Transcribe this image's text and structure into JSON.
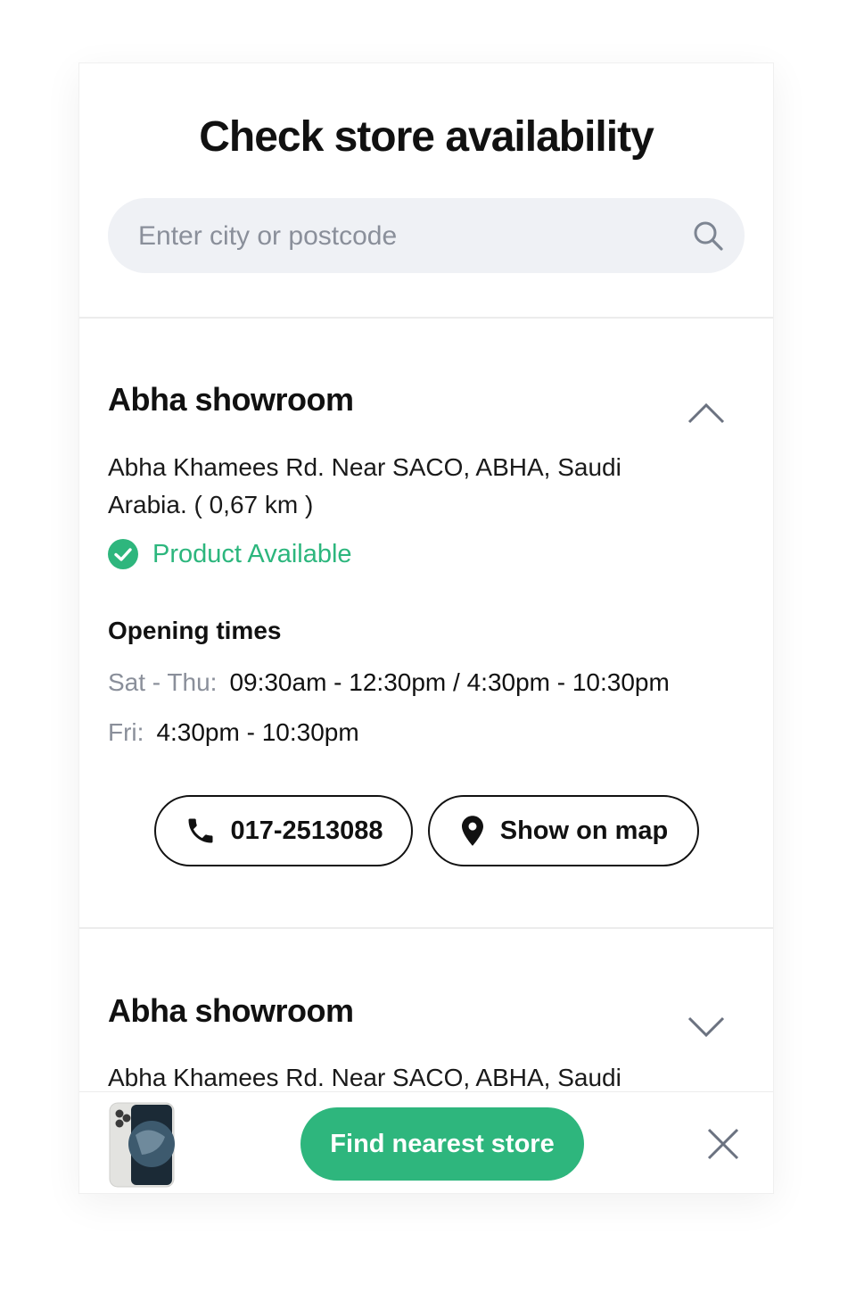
{
  "title": "Check store availability",
  "search": {
    "placeholder": "Enter city or postcode"
  },
  "stores": [
    {
      "name": "Abha showroom",
      "address": "Abha Khamees Rd. Near SACO, ABHA, Saudi Arabia. ( 0,67 km )",
      "availability": "Product Available",
      "opening_times_heading": "Opening times",
      "hours": [
        {
          "label": "Sat - Thu:",
          "value": "09:30am - 12:30pm / 4:30pm - 10:30pm"
        },
        {
          "label": "Fri:",
          "value": "4:30pm - 10:30pm"
        }
      ],
      "phone": "017-2513088",
      "map_label": "Show on map",
      "expanded": true
    },
    {
      "name": "Abha showroom",
      "address": "Abha Khamees Rd. Near SACO, ABHA, Saudi",
      "expanded": false
    }
  ],
  "bottom_bar": {
    "cta_label": "Find nearest store"
  },
  "colors": {
    "accent": "#2eb67d",
    "muted": "#8a8f9a",
    "search_bg": "#eff1f5"
  },
  "icons": [
    "search-icon",
    "chevron-up-icon",
    "check-circle-icon",
    "phone-icon",
    "map-pin-icon",
    "chevron-down-icon",
    "close-icon"
  ]
}
